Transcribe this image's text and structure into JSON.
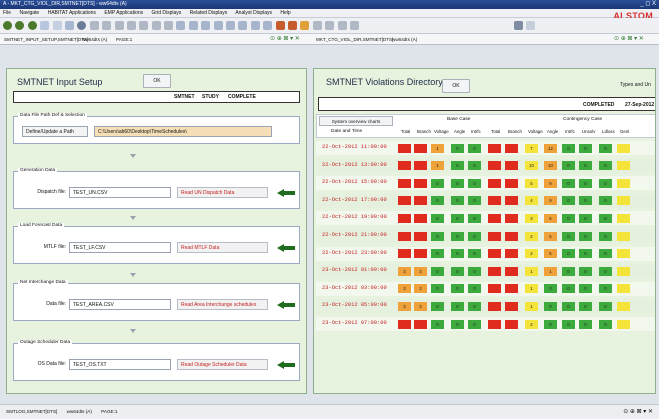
{
  "window": {
    "title": "A - MKT_CTG_VIOL_DIR,SMTNET[DTS] - ww64dts (A)",
    "controls": "_ ◻ X",
    "brand": "ALSTOM"
  },
  "menu": [
    "File",
    "Navigate",
    "HABITAT Applications",
    "EMP Applications",
    "Grid Displays",
    "Related Displays",
    "Analyst Displays",
    "Help"
  ],
  "tabs": {
    "left": "SMTNET_INPUT_SETUP,SMTNET[DTS]",
    "left_host": "ww64dts (A)",
    "left_page": "PAGE:1",
    "right": "MKT_CTG_VIOL_DIR,SMTNET[DTS]",
    "right_host": "ww64dts (A)"
  },
  "left_panel": {
    "title": "SMTNET Input Setup",
    "ok": "OK",
    "sub_labels": [
      "SMTNET",
      "STUDY",
      "COMPLETE"
    ],
    "groups": [
      {
        "label": "Data File Path Def & Selection",
        "field_label": "Define/Update a Path",
        "value": "C:\\Users\\ab60\\Desktop\\TimeSchedules\\",
        "button": ""
      },
      {
        "label": "Generation Data",
        "field_label": "Dispatch file:",
        "value": "TEST_UN.CSV",
        "button": "Read UN Dispatch Data"
      },
      {
        "label": "Load Forecast Data",
        "field_label": "MTLF file:",
        "value": "TEST_LF.CSV",
        "button": "Read MTLF Data"
      },
      {
        "label": "Net Interchange Data",
        "field_label": "Data file:",
        "value": "TEST_AREA.CSV",
        "button": "Read Area Interchange schedules"
      },
      {
        "label": "Outage Scheduler Data",
        "field_label": "OS Data file:",
        "value": "TEST_OS.TXT",
        "button": "Read Outage Scheduler Data"
      }
    ]
  },
  "right_panel": {
    "title": "SMTNET Violations Directory",
    "ok": "OK",
    "types_button": "Types and Un",
    "status": "COMPLETED",
    "date": "27-Sep-2012",
    "overview_button": "System overview charts",
    "col_datetime": "Date and Time",
    "base_case": "Base Case",
    "contingency_case": "Contingency Case",
    "columns": [
      "Total",
      "Branch",
      "Voltage",
      "Angle",
      "Intrfc",
      "Total",
      "Branch",
      "Voltage",
      "Angle",
      "Intrfc",
      "Unsolv",
      "Ldloss",
      "Genl"
    ],
    "rows": [
      {
        "time": "22-Oct-2012 11:00:00",
        "cells": [
          "",
          "",
          "1",
          "0",
          "0",
          "",
          "",
          "7",
          "12",
          "0",
          "0",
          "0",
          ""
        ]
      },
      {
        "time": "22-Oct-2012 13:00:00",
        "cells": [
          "",
          "",
          "1",
          "0",
          "0",
          "",
          "",
          "10",
          "10",
          "0",
          "0",
          "0",
          ""
        ]
      },
      {
        "time": "22-Oct-2012 15:00:00",
        "cells": [
          "",
          "",
          "0",
          "0",
          "0",
          "",
          "",
          "5",
          "9",
          "0",
          "0",
          "0",
          ""
        ]
      },
      {
        "time": "22-Oct-2012 17:00:00",
        "cells": [
          "",
          "",
          "0",
          "0",
          "0",
          "",
          "",
          "4",
          "9",
          "0",
          "0",
          "0",
          ""
        ]
      },
      {
        "time": "22-Oct-2012 19:00:00",
        "cells": [
          "",
          "",
          "0",
          "0",
          "0",
          "",
          "",
          "3",
          "6",
          "0",
          "0",
          "0",
          ""
        ]
      },
      {
        "time": "22-Oct-2012 21:00:00",
        "cells": [
          "",
          "",
          "0",
          "0",
          "0",
          "",
          "",
          "2",
          "5",
          "0",
          "0",
          "0",
          ""
        ]
      },
      {
        "time": "22-Oct-2012 23:00:00",
        "cells": [
          "",
          "",
          "0",
          "0",
          "0",
          "",
          "",
          "2",
          "5",
          "0",
          "0",
          "0",
          ""
        ]
      },
      {
        "time": "23-Oct-2012 01:00:00",
        "cells": [
          "3",
          "3",
          "0",
          "0",
          "0",
          "",
          "",
          "1",
          "1",
          "0",
          "0",
          "0",
          ""
        ]
      },
      {
        "time": "23-Oct-2012 03:00:00",
        "cells": [
          "3",
          "3",
          "0",
          "0",
          "0",
          "",
          "",
          "1",
          "0",
          "0",
          "0",
          "0",
          ""
        ]
      },
      {
        "time": "23-Oct-2012 05:00:00",
        "cells": [
          "3",
          "3",
          "0",
          "0",
          "0",
          "",
          "",
          "1",
          "0",
          "0",
          "0",
          "0",
          ""
        ]
      },
      {
        "time": "23-Oct-2012 07:00:00",
        "cells": [
          "",
          "",
          "0",
          "0",
          "0",
          "",
          "",
          "2",
          "0",
          "0",
          "0",
          "0",
          ""
        ]
      }
    ],
    "row_colors": [
      [
        "red",
        "red",
        "orange",
        "green",
        "green",
        "red",
        "red",
        "yellow",
        "orange",
        "green",
        "green",
        "green",
        "yellow"
      ],
      [
        "red",
        "red",
        "orange",
        "green",
        "green",
        "red",
        "red",
        "yellow",
        "orange",
        "green",
        "green",
        "green",
        "yellow"
      ],
      [
        "red",
        "red",
        "green",
        "green",
        "green",
        "red",
        "red",
        "yellow",
        "orange",
        "green",
        "green",
        "green",
        "yellow"
      ],
      [
        "red",
        "red",
        "green",
        "green",
        "green",
        "red",
        "red",
        "yellow",
        "orange",
        "green",
        "green",
        "green",
        "yellow"
      ],
      [
        "red",
        "red",
        "green",
        "green",
        "green",
        "red",
        "red",
        "yellow",
        "orange",
        "green",
        "green",
        "green",
        "yellow"
      ],
      [
        "red",
        "red",
        "green",
        "green",
        "green",
        "red",
        "red",
        "yellow",
        "orange",
        "green",
        "green",
        "green",
        "yellow"
      ],
      [
        "red",
        "red",
        "green",
        "green",
        "green",
        "red",
        "red",
        "yellow",
        "orange",
        "green",
        "green",
        "green",
        "yellow"
      ],
      [
        "orange",
        "orange",
        "green",
        "green",
        "green",
        "red",
        "red",
        "yellow",
        "orange",
        "green",
        "green",
        "green",
        "yellow"
      ],
      [
        "orange",
        "orange",
        "green",
        "green",
        "green",
        "red",
        "red",
        "yellow",
        "green",
        "green",
        "green",
        "green",
        "yellow"
      ],
      [
        "orange",
        "orange",
        "green",
        "green",
        "green",
        "red",
        "red",
        "yellow",
        "green",
        "green",
        "green",
        "green",
        "yellow"
      ],
      [
        "red",
        "red",
        "green",
        "green",
        "green",
        "red",
        "red",
        "yellow",
        "green",
        "green",
        "green",
        "green",
        "yellow"
      ]
    ]
  },
  "status_bar": {
    "left_tab": "SMTLOG,SMTNET[DTS]",
    "host": "ww64dts (A)",
    "page": "PAGE:1"
  },
  "colors": {
    "red": "#e02b1f",
    "orange": "#f0a23a",
    "green": "#3caa3c",
    "yellow": "#f4e43a"
  }
}
